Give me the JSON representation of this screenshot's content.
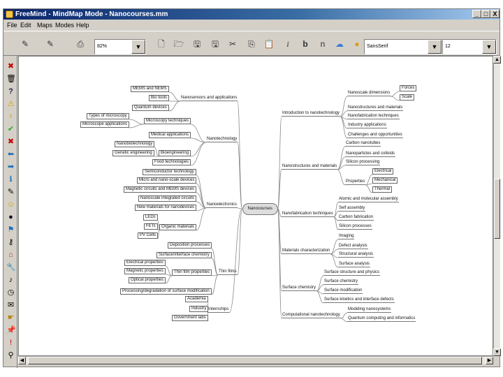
{
  "window": {
    "title": "FreeMind - MindMap Mode - Nanocourses.mm",
    "controls": {
      "minimize": "_",
      "maximize": "□",
      "close": "X"
    }
  },
  "menu": [
    "File",
    "Edit",
    "Maps",
    "Modes",
    "Help"
  ],
  "toolbar": {
    "zoom_value": "82%",
    "font_value": "SansSerif",
    "size_value": "12",
    "format_buttons": {
      "italic": "i",
      "bold": "b",
      "normal": "n"
    }
  },
  "mindmap": {
    "center": "Nanocourses",
    "right": [
      {
        "label": "Introduction to nanotechnology",
        "children": [
          {
            "label": "Nanoscale dimensions",
            "children": [
              {
                "label": "Forces"
              },
              {
                "label": "Scale"
              }
            ]
          },
          {
            "label": "Nanostructures and materials"
          },
          {
            "label": "Nanofabrication techniques"
          },
          {
            "label": "Industry applications"
          },
          {
            "label": "Challenges and opportunities"
          }
        ]
      },
      {
        "label": "Nanostructures and materials",
        "children": [
          {
            "label": "Carbon nanotubes"
          },
          {
            "label": "Nanoparticles and colloids"
          },
          {
            "label": "Silicon processing"
          },
          {
            "label": "Properties",
            "children": [
              {
                "label": "Electrical"
              },
              {
                "label": "Mechanical"
              },
              {
                "label": "Thermal"
              }
            ]
          }
        ]
      },
      {
        "label": "Nanofabrication techniques",
        "children": [
          {
            "label": "Atomic and molecular assembly"
          },
          {
            "label": "Self assembly"
          },
          {
            "label": "Carbon fabrication"
          },
          {
            "label": "Silicon processes"
          }
        ]
      },
      {
        "label": "Materials characterization",
        "children": [
          {
            "label": "Imaging"
          },
          {
            "label": "Defect analysis"
          },
          {
            "label": "Structural analysis"
          },
          {
            "label": "Surface analysis"
          }
        ]
      },
      {
        "label": "Surface chemistry",
        "children": [
          {
            "label": "Surface structure and physics"
          },
          {
            "label": "Surface chemistry"
          },
          {
            "label": "Surface modification"
          },
          {
            "label": "Surface kinetics and interface defects"
          }
        ]
      },
      {
        "label": "Computational nanotechnology",
        "children": [
          {
            "label": "Modeling nanosystems"
          },
          {
            "label": "Quantum computing and informatics"
          }
        ]
      }
    ],
    "left": [
      {
        "label": "Nanosensors and applications",
        "children": [
          {
            "label": "MEMS and NEMS"
          },
          {
            "label": "Bio tools"
          },
          {
            "label": "Quantum devices"
          }
        ]
      },
      {
        "label": "Nanotechnology",
        "children": [
          {
            "label": "Microscopy techniques",
            "children": [
              {
                "label": "Types of microscopy"
              },
              {
                "label": "Microscope applications"
              }
            ]
          },
          {
            "label": "Medical applications"
          },
          {
            "label": "Bioengineering",
            "children": [
              {
                "label": "Nanobiotechnology"
              },
              {
                "label": "Genetic engineering"
              }
            ]
          },
          {
            "label": "Food technologies"
          }
        ]
      },
      {
        "label": "Nanoelectronics",
        "children": [
          {
            "label": "Semiconductor technology"
          },
          {
            "label": "Micro and nano-scale devices"
          },
          {
            "label": "Magnetic circuits and MEMS devices"
          },
          {
            "label": "Nanoscale integrated circuits"
          },
          {
            "label": "New materials for nanodevices"
          },
          {
            "label": "Organic materials",
            "children": [
              {
                "label": "LEDs"
              },
              {
                "label": "FETs"
              },
              {
                "label": "PV Cells"
              }
            ]
          }
        ]
      },
      {
        "label": "Thin films",
        "children": [
          {
            "label": "Deposition processes"
          },
          {
            "label": "Surface/interface chemistry"
          },
          {
            "label": "Thin film properties",
            "children": [
              {
                "label": "Electrical properties"
              },
              {
                "label": "Magnetic properties"
              },
              {
                "label": "Optical properties"
              }
            ]
          },
          {
            "label": "Processing/degradation of surface modification"
          }
        ]
      },
      {
        "label": "Internships",
        "children": [
          {
            "label": "Academia"
          },
          {
            "label": "Industry"
          },
          {
            "label": "Government labs"
          }
        ]
      }
    ]
  }
}
